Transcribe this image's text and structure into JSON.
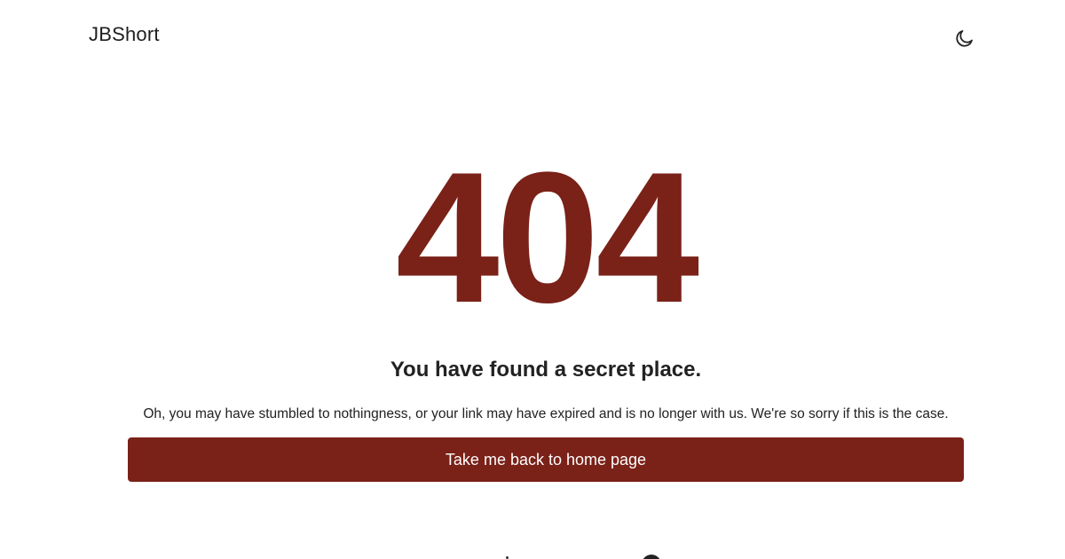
{
  "header": {
    "brand": "JBShort",
    "theme_toggle_icon": "moon-icon"
  },
  "error": {
    "code": "404",
    "headline": "You have found a secret place.",
    "message": "Oh, you may have stumbled to nothingness, or your link may have expired and is no longer with us. We're so sorry if this is the case.",
    "button_label": "Take me back to home page"
  },
  "colors": {
    "accent": "#7a2118",
    "text": "#222222",
    "background": "#ffffff"
  }
}
